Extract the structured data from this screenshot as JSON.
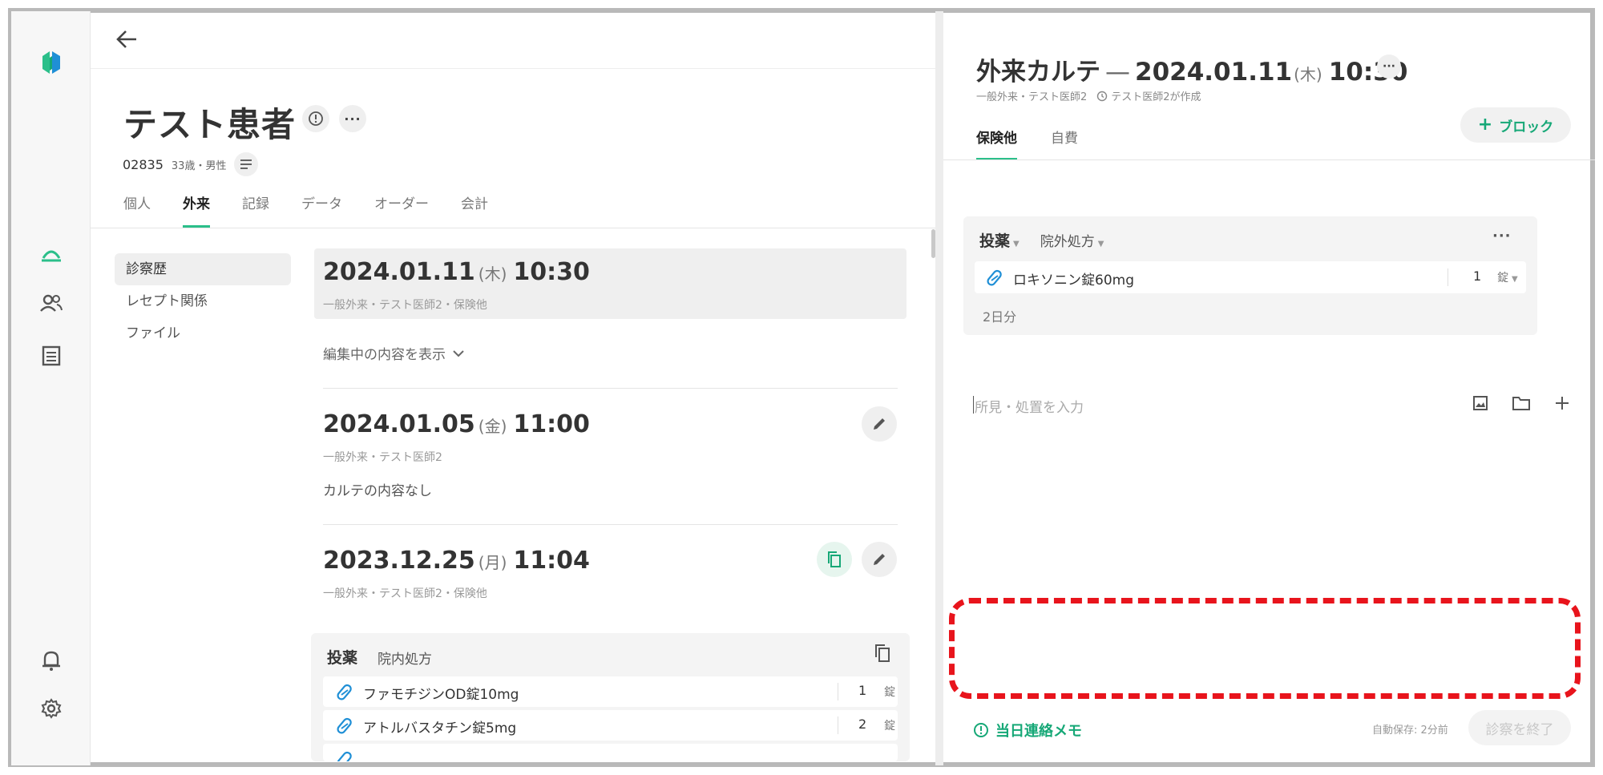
{
  "colors": {
    "accent": "#2bbf8a",
    "accent_text": "#16a877",
    "highlight": "#e8141c"
  },
  "rail": {
    "icons": [
      "app-logo-icon",
      "outpatient-bell-icon",
      "patients-icon",
      "records-list-icon",
      "notification-bell-icon",
      "settings-gear-icon"
    ]
  },
  "patient": {
    "name": "テスト患者",
    "id": "02835",
    "age_sex": "33歳・男性",
    "tabs": [
      "個人",
      "外来",
      "記録",
      "データ",
      "オーダー",
      "会計"
    ],
    "active_tab": "外来"
  },
  "subnav": [
    "診察歴",
    "レセプト関係",
    "ファイル"
  ],
  "visits": [
    {
      "date": "2024.01.11",
      "weekday": "(木)",
      "time": "10:30",
      "info": "一般外来・テスト医師2・保険他"
    },
    {
      "date": "2024.01.05",
      "weekday": "(金)",
      "time": "11:00",
      "info": "一般外来・テスト医師2",
      "note": "カルテの内容なし"
    },
    {
      "date": "2023.12.25",
      "weekday": "(月)",
      "time": "11:04",
      "info": "一般外来・テスト医師2・保険他"
    }
  ],
  "show_editing": "編集中の内容を表示",
  "history_rx": {
    "title": "投薬",
    "type": "院内処方",
    "items": [
      {
        "name": "ファモチジンOD錠10mg",
        "qty": "1",
        "unit": "錠"
      },
      {
        "name": "アトルバスタチン錠5mg",
        "qty": "2",
        "unit": "錠"
      }
    ]
  },
  "karte": {
    "title": "外来カルテ",
    "dash": "—",
    "date": "2024.01.11",
    "weekday": "(木)",
    "time": "10:30",
    "sub_info": "一般外来・テスト医師2",
    "author": "テスト医師2が作成",
    "tabs": [
      "保険他",
      "自費"
    ],
    "add_block": "ブロック",
    "rx": {
      "title": "投薬",
      "type": "院外処方",
      "item": {
        "name": "ロキソニン錠60mg",
        "qty": "1",
        "unit": "錠"
      },
      "days": "2日分"
    },
    "finding_placeholder": "所見・処置を入力",
    "memo": "当日連絡メモ",
    "autosave": "自動保存: 2分前",
    "finish": "診察を終了"
  }
}
